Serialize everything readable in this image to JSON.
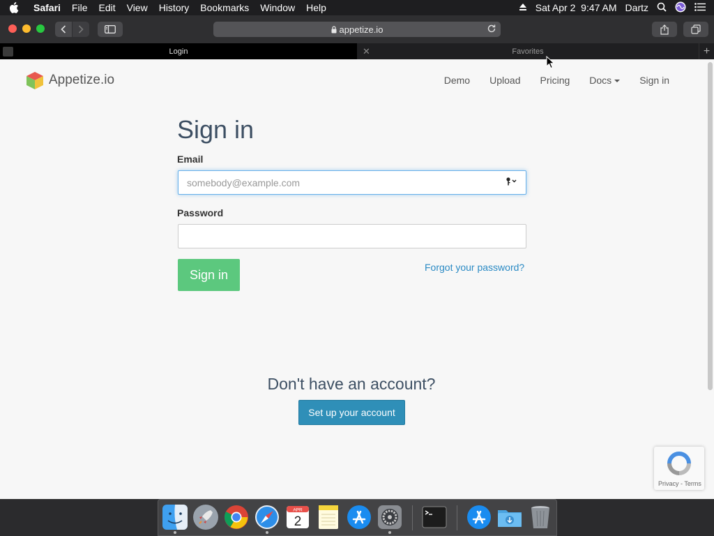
{
  "menubar": {
    "app_name": "Safari",
    "items": [
      "File",
      "Edit",
      "View",
      "History",
      "Bookmarks",
      "Window",
      "Help"
    ],
    "datetime": "Sat Apr 2  9:47 AM",
    "user": "Dartz"
  },
  "toolbar": {
    "url": "appetize.io"
  },
  "tabs": {
    "active_title": "Login",
    "inactive_title": "Favorites"
  },
  "site": {
    "brand": "Appetize.io",
    "nav": {
      "demo": "Demo",
      "upload": "Upload",
      "pricing": "Pricing",
      "docs": "Docs",
      "signin": "Sign in"
    }
  },
  "form": {
    "title": "Sign in",
    "email_label": "Email",
    "email_placeholder": "somebody@example.com",
    "password_label": "Password",
    "submit_label": "Sign in",
    "forgot_label": "Forgot your password?"
  },
  "signup": {
    "heading": "Don't have an account?",
    "button_label": "Set up your account"
  },
  "recaptcha": {
    "text": "Privacy - Terms"
  },
  "calendar": {
    "month": "APR",
    "day": "2"
  },
  "colors": {
    "signin_button": "#5cc87e",
    "setup_button": "#2f8fb8",
    "link": "#2a8ac4",
    "heading": "#3d4f63"
  }
}
